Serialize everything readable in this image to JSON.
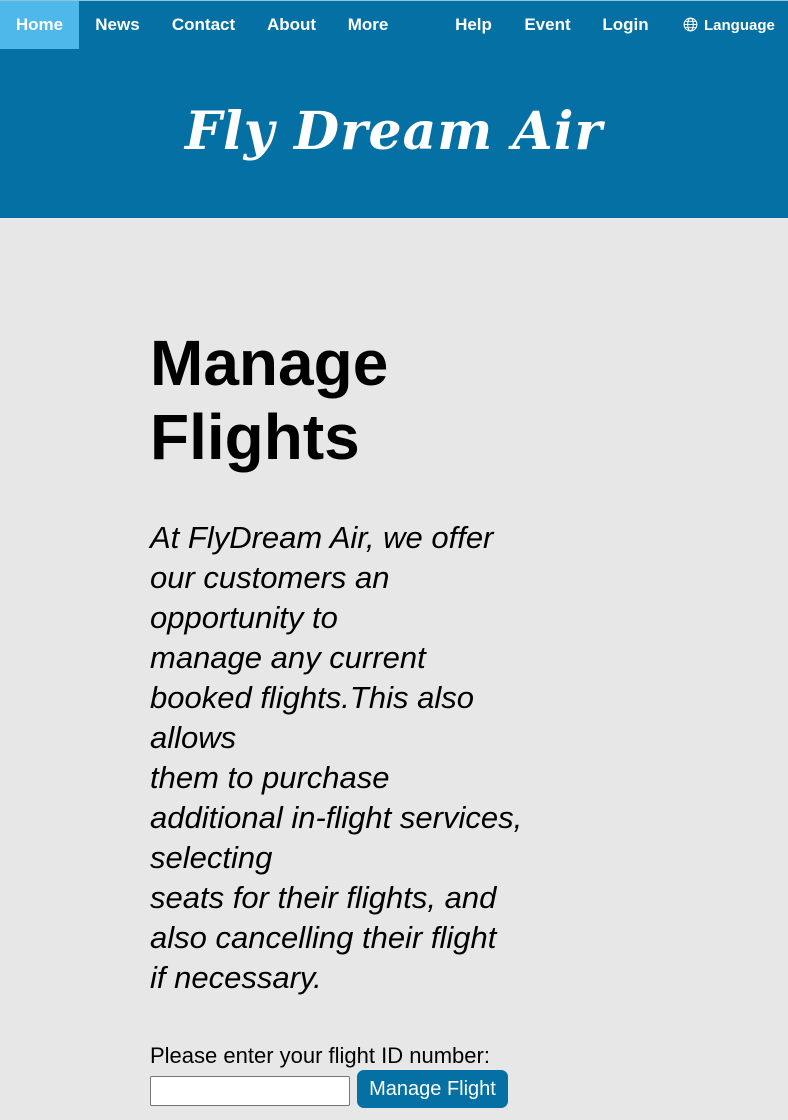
{
  "nav": {
    "items": [
      {
        "label": "Home",
        "active": true
      },
      {
        "label": "News"
      },
      {
        "label": "Contact"
      },
      {
        "label": "About"
      },
      {
        "label": "More"
      },
      {
        "label": "Help"
      },
      {
        "label": "Event"
      },
      {
        "label": "Login"
      }
    ],
    "language": {
      "label": "Language",
      "icon": "globe-icon"
    }
  },
  "header": {
    "brand": "Fly Dream Air"
  },
  "main": {
    "title_lines": [
      "Manage",
      "Flights"
    ],
    "description_lines": [
      "At FlyDream Air, we offer",
      "our customers an",
      "opportunity to",
      "manage any current",
      "booked flights.This also",
      "allows",
      "them to purchase",
      "additional in-flight services,",
      "selecting",
      "seats for their flights, and",
      "also cancelling their flight",
      "if necessary."
    ],
    "form": {
      "label": "Please enter your flight ID number:",
      "input_value": "",
      "input_placeholder": "",
      "button_label": "Manage Flight"
    }
  },
  "colors": {
    "primary": "#0470a3",
    "active_tab": "#4fb8eb",
    "background": "#e7e7e7",
    "text": "#000000",
    "on_primary": "#ffffff"
  }
}
